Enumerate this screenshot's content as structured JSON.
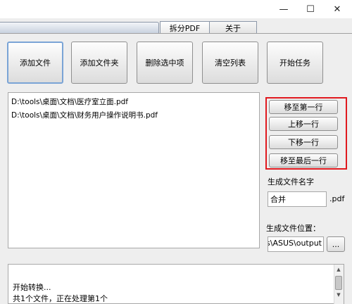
{
  "window": {
    "min_glyph": "—",
    "max_glyph": "☐",
    "close_glyph": "✕"
  },
  "tabs": [
    {
      "label": "拆分PDF"
    },
    {
      "label": "关于"
    }
  ],
  "toolbar": {
    "add_file": "添加文件",
    "add_folder": "添加文件夹",
    "delete_selected": "删除选中项",
    "clear_list": "清空列表",
    "start_task": "开始任务"
  },
  "files": [
    "D:\\tools\\桌面\\文档\\医疗室立面.pdf",
    "D:\\tools\\桌面\\文档\\财务用户操作说明书.pdf"
  ],
  "move": {
    "to_first": "移至第一行",
    "up": "上移一行",
    "down": "下移一行",
    "to_last": "移至最后一行",
    "highlight_color": "#e0191e"
  },
  "output": {
    "name_label": "生成文件名字",
    "name_value": "合并",
    "ext": ".pdf",
    "location_label": "生成文件位置：",
    "location_value": "ers\\ASUS\\output",
    "browse": "..."
  },
  "log": [
    "开始转换...",
    "共1个文件，正在处理第1个"
  ],
  "icons": {
    "scroll_up": "▲",
    "scroll_down": "▼"
  }
}
